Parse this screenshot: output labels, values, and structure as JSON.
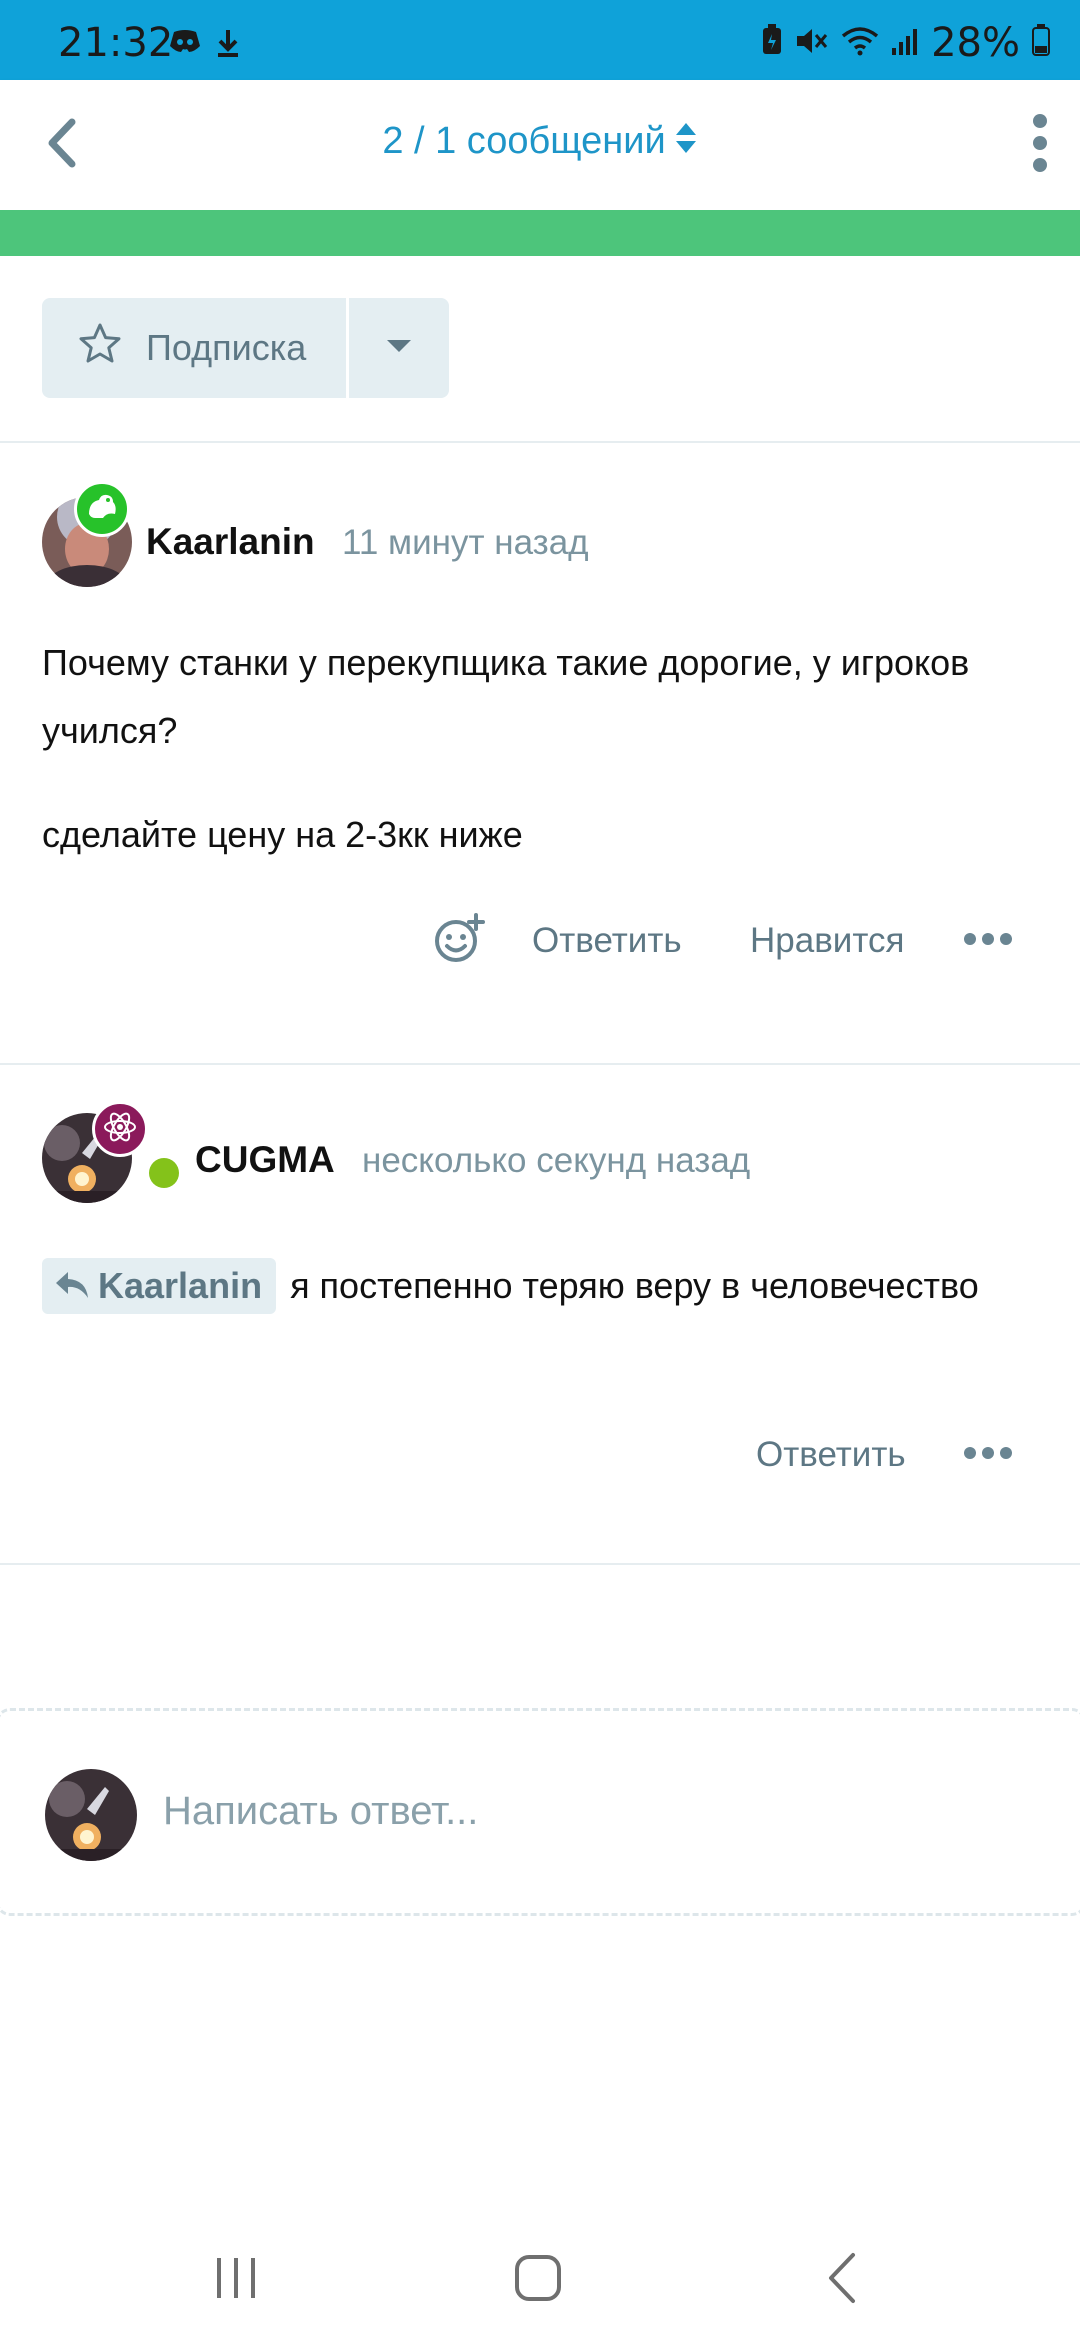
{
  "status_bar": {
    "time": "21:32",
    "battery": "28%",
    "left_icons": [
      "discord-icon",
      "download-icon"
    ],
    "right_icons": [
      "battery-saver-icon",
      "mute-icon",
      "wifi-icon",
      "signal-icon",
      "battery-icon"
    ]
  },
  "header": {
    "counter": "2 / 1 сообщений",
    "back_icon": "chevron-left-icon",
    "sort_icon": "sort-updown-icon",
    "menu_icon": "kebab-menu-icon"
  },
  "subscribe": {
    "label": "Подписка",
    "icon": "star-outline-icon",
    "caret_icon": "caret-down-icon"
  },
  "posts": [
    {
      "author": "Kaarlanin",
      "time": "11 минут назад",
      "badge_icon": "frog-icon",
      "badge_color": "#27c22a",
      "paragraphs": [
        "Почему станки у перекупщика такие дорогие, у игроков учился?",
        "сделайте цену на 2-3кк ниже"
      ],
      "actions": {
        "react_icon": "add-reaction-icon",
        "reply": "Ответить",
        "like": "Нравится",
        "more_icon": "more-dots-icon"
      }
    },
    {
      "author": "CUGMA",
      "time": "несколько секунд назад",
      "badge_icon": "atom-icon",
      "badge_color": "#8b1a5b",
      "online": true,
      "quote_target": "Kaarlanin",
      "quote_icon": "reply-arrow-icon",
      "text": "я постепенно теряю веру в человечество",
      "actions": {
        "reply": "Ответить",
        "more_icon": "more-dots-icon"
      }
    }
  ],
  "reply_box": {
    "placeholder": "Написать ответ..."
  },
  "nav_bar": {
    "items": [
      "recent-apps-icon",
      "home-icon",
      "back-icon"
    ]
  },
  "colors": {
    "status_bar": "#0fa2d9",
    "accent": "#1e95c8",
    "green_strip": "#4dc57b",
    "muted": "#5d7784",
    "online": "#84c21a"
  }
}
